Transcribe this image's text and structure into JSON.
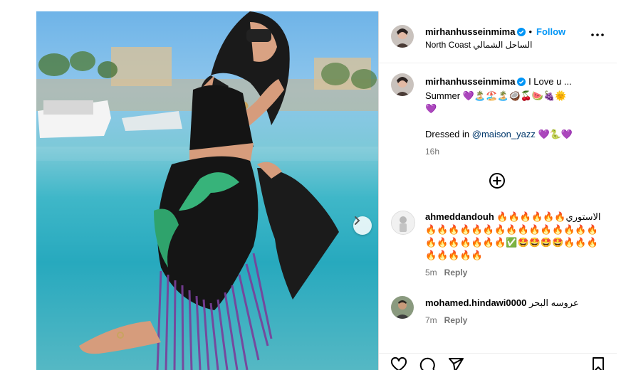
{
  "post": {
    "author": "mirhanhusseinmima",
    "follow_label": "Follow",
    "dot": "•",
    "location": "North Coast الساحل الشمالي"
  },
  "caption": {
    "author": "mirhanhusseinmima",
    "line1": "I Love u ...",
    "line2": "Summer 💜🏝️🏖️🏝️🥥🍒🍉🍇🌞",
    "line3": "💜",
    "dressed_prefix": "Dressed in ",
    "mention": "@maison_yazz",
    "dressed_suffix": " 💜🐍💜",
    "time": "16h"
  },
  "comments": [
    {
      "user": "ahmeddandouh",
      "text": "🔥🔥🔥🔥🔥🔥الاستوري 🔥🔥🔥🔥🔥🔥🔥🔥🔥🔥🔥🔥🔥🔥🔥🔥🔥🔥🔥🔥🔥🔥✅🤩🤩🤩🤩🔥🔥🔥🔥🔥🔥🔥🔥",
      "time": "5m",
      "reply": "Reply"
    },
    {
      "user": "mohamed.hindawi0000",
      "text": "عروسه البحر",
      "time": "7m",
      "reply": "Reply"
    }
  ],
  "icons": [
    "verified-icon",
    "more-icon",
    "chevron-right-icon",
    "plus-circle-icon",
    "heart-icon",
    "comment-icon",
    "share-icon",
    "bookmark-icon"
  ],
  "colors": {
    "accent": "#0095f6",
    "mention": "#00376b",
    "muted": "#737373",
    "verified": "#0095f6"
  }
}
